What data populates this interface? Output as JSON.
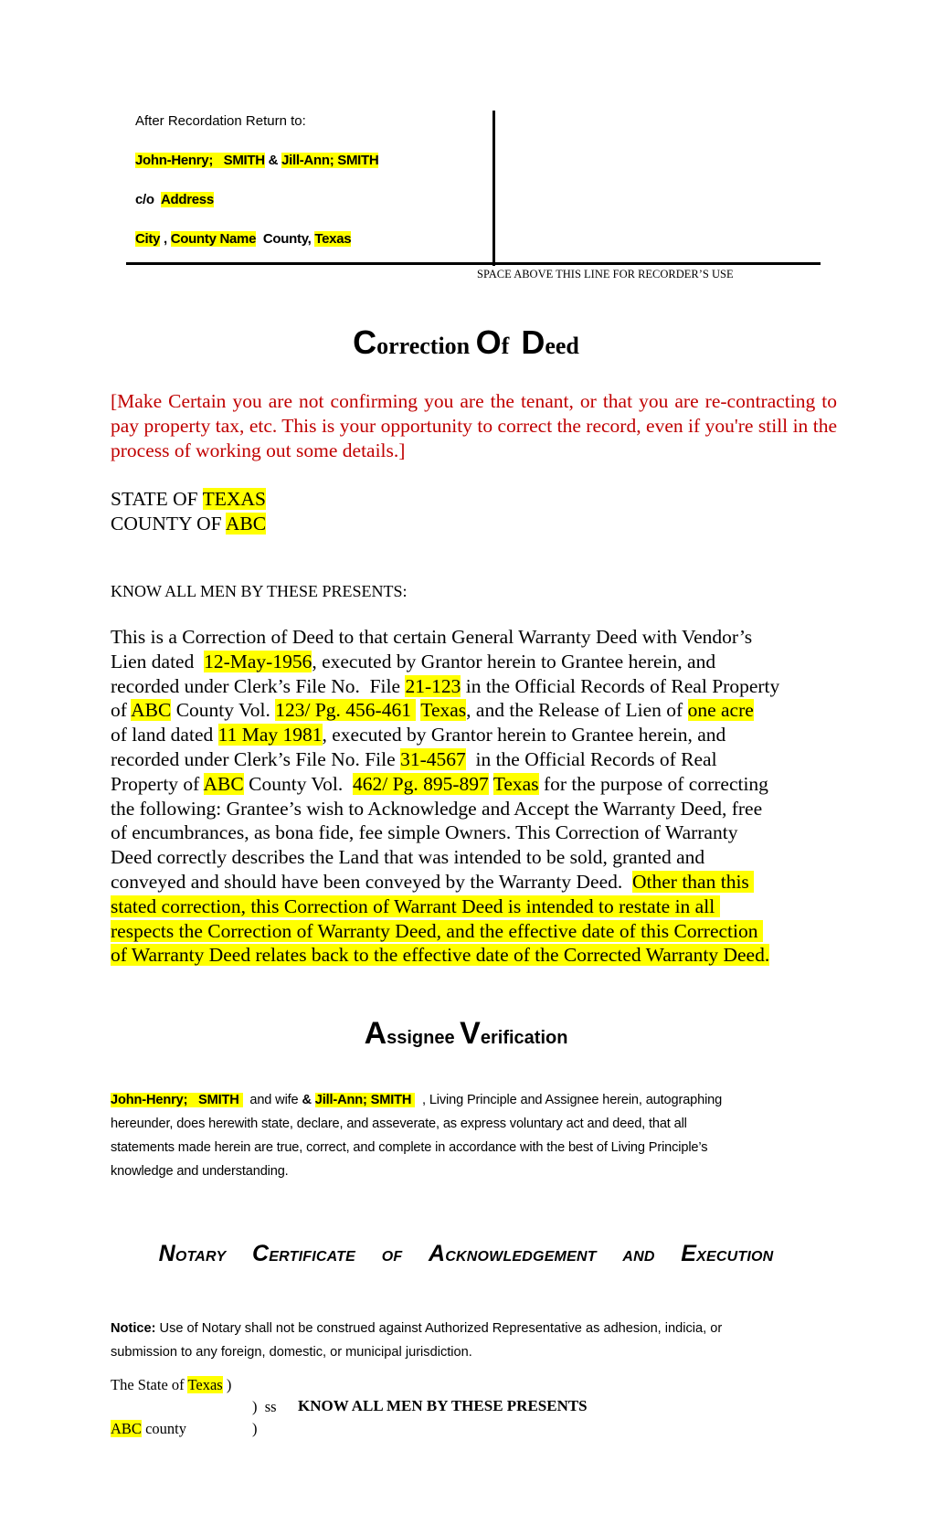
{
  "return_block": {
    "label": "After Recordation Return to:",
    "grantee1": "John-Henry;   SMITH",
    "amp": " & ",
    "grantee2": "Jill-Ann; SMITH",
    "co_prefix": "c/o  ",
    "address": "Address",
    "city": "City",
    "comma": " , ",
    "county_name": "County Name",
    "county_suffix": "  County, ",
    "state": "Texas"
  },
  "recorder_note": "SPACE ABOVE THIS LINE FOR RECORDER’S USE",
  "title": {
    "c_cap": "C",
    "c_rest": "orrection ",
    "o_cap": "O",
    "o_rest": "f  ",
    "d_cap": "D",
    "d_rest": "eed"
  },
  "instructions": "[Make Certain you are not confirming you are the tenant, or that you are re-contracting to pay property tax, etc.  This is your opportunity to correct the record, even if you're still in the process of working out some details.]",
  "state_block": {
    "state_label": "STATE OF ",
    "state_value": "TEXAS",
    "county_label": "COUNTY OF ",
    "county_value": "ABC"
  },
  "know_all": "KNOW ALL MEN BY THESE PRESENTS:",
  "main_paragraph": {
    "l1": "This is a Correction of Deed to that certain General Warranty Deed with Vendor’s",
    "l2a": "Lien dated  ",
    "deed_date": "12-May-1956",
    "l2b": ", executed by Grantor herein to Grantee herein, and",
    "l3a": "recorded under Clerk’s File No.  File ",
    "file1": "21-123",
    "l3b": " in the Official Records of Real Property",
    "l4a": "of ",
    "county1": "ABC",
    "l4b": " County Vol. ",
    "vol1": "123/ Pg. 456-461 ",
    "l4c": " ",
    "state1": "Texas",
    "l4d": ", and the Release of Lien of ",
    "acreage": "one acre",
    "l5a": "of land dated ",
    "lien_date": "11 May 1981",
    "l5b": ", executed by Grantor herein to Grantee herein, and",
    "l6a": "recorded under Clerk’s File No. File ",
    "file2": "31-4567",
    "l6b": "  in the Official Records of Real",
    "l7a": "Property of ",
    "county2": "ABC",
    "l7b": " County Vol.  ",
    "vol2": "462/ Pg. 895-897",
    "l7c": " ",
    "state2": "Texas",
    "l7d": " for the purpose of correcting",
    "l8": "the following: Grantee’s wish to Acknowledge and Accept the Warranty Deed, free",
    "l9": "of encumbrances, as bona fide, fee simple Owners. This Correction of Warranty",
    "l10": "Deed correctly describes the Land that was intended to be sold, granted and",
    "l11a": "conveyed and should have been conveyed by the Warranty Deed.  ",
    "l11b": "Other than this ",
    "l12": "stated correction, this Correction of Warrant Deed is intended to restate in all ",
    "l13": "respects the Correction of Warranty Deed, and the effective date of this Correction ",
    "l14": "of Warranty Deed relates back to the effective date of the Corrected Warranty Deed."
  },
  "assignee": {
    "title_a_cap": "A",
    "title_a_rest": "ssignee ",
    "title_v_cap": "V",
    "title_v_rest": "erification",
    "name1": "John-Henry;   SMITH ",
    "and_wife": "  and wife ",
    "amp": "& ",
    "name2": "Jill-Ann; SMITH ",
    "l1_rest": "  , Living Principle and Assignee herein, autographing",
    "l2": "hereunder, does herewith state, declare, and asseverate, as express voluntary act and deed, that all",
    "l3": "statements made herein are true, correct, and complete in accordance with the best of Living Principle’s",
    "l4": "knowledge and understanding."
  },
  "notary": {
    "words": [
      {
        "cap": "N",
        "rest": "OTARY"
      },
      {
        "cap": "C",
        "rest": "ERTIFICATE"
      },
      {
        "cap": "",
        "rest": "OF"
      },
      {
        "cap": "A",
        "rest": "CKNOWLEDGEMENT"
      },
      {
        "cap": "",
        "rest": "AND"
      },
      {
        "cap": "E",
        "rest": "XECUTION"
      }
    ],
    "notice_label": "Notice:",
    "notice_l1": " Use of Notary shall not be construed against Authorized Representative as adhesion, indicia, or",
    "notice_l2": "submission to any foreign, domestic, or municipal jurisdiction."
  },
  "venue": {
    "state_prefix": "The State of ",
    "state_value": "Texas",
    "state_paren": " )",
    "ss": ")  ss",
    "know_all": "KNOW ALL MEN BY THESE PRESENTS",
    "county_value": "ABC",
    "county_suffix": " county",
    "county_paren": ")"
  },
  "colors": {
    "highlight": "#ffff00",
    "instruction_red": "#c00000"
  }
}
